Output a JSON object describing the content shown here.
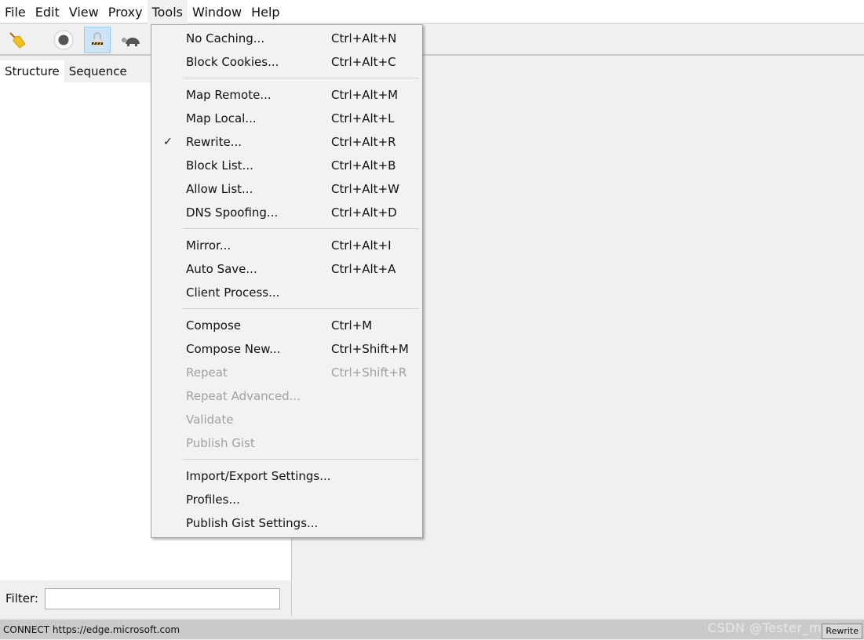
{
  "menubar": [
    "File",
    "Edit",
    "View",
    "Proxy",
    "Tools",
    "Window",
    "Help"
  ],
  "toolbar": {
    "icons": [
      "broom-icon",
      "record-icon",
      "ssl-lock-icon",
      "throttle-turtle-icon"
    ]
  },
  "tabs": [
    "Structure",
    "Sequence"
  ],
  "filter": {
    "label": "Filter:",
    "value": ""
  },
  "status": {
    "text": "CONNECT https://edge.microsoft.com",
    "button": "Rewrite",
    "watermark": "CSDN @Tester_muller"
  },
  "menu": {
    "groups": [
      [
        {
          "label": "No Caching...",
          "shortcut": "Ctrl+Alt+N"
        },
        {
          "label": "Block Cookies...",
          "shortcut": "Ctrl+Alt+C"
        }
      ],
      [
        {
          "label": "Map Remote...",
          "shortcut": "Ctrl+Alt+M"
        },
        {
          "label": "Map Local...",
          "shortcut": "Ctrl+Alt+L"
        },
        {
          "label": "Rewrite...",
          "shortcut": "Ctrl+Alt+R",
          "checked": true
        },
        {
          "label": "Block List...",
          "shortcut": "Ctrl+Alt+B"
        },
        {
          "label": "Allow List...",
          "shortcut": "Ctrl+Alt+W"
        },
        {
          "label": "DNS Spoofing...",
          "shortcut": "Ctrl+Alt+D"
        }
      ],
      [
        {
          "label": "Mirror...",
          "shortcut": "Ctrl+Alt+I"
        },
        {
          "label": "Auto Save...",
          "shortcut": "Ctrl+Alt+A"
        },
        {
          "label": "Client Process...",
          "shortcut": ""
        }
      ],
      [
        {
          "label": "Compose",
          "shortcut": "Ctrl+M"
        },
        {
          "label": "Compose New...",
          "shortcut": "Ctrl+Shift+M"
        },
        {
          "label": "Repeat",
          "shortcut": "Ctrl+Shift+R",
          "disabled": true
        },
        {
          "label": "Repeat Advanced...",
          "shortcut": "",
          "disabled": true
        },
        {
          "label": "Validate",
          "shortcut": "",
          "disabled": true
        },
        {
          "label": "Publish Gist",
          "shortcut": "",
          "disabled": true
        }
      ],
      [
        {
          "label": "Import/Export Settings...",
          "shortcut": ""
        },
        {
          "label": "Profiles...",
          "shortcut": ""
        },
        {
          "label": "Publish Gist Settings...",
          "shortcut": ""
        }
      ]
    ],
    "check_mark": "✓"
  }
}
